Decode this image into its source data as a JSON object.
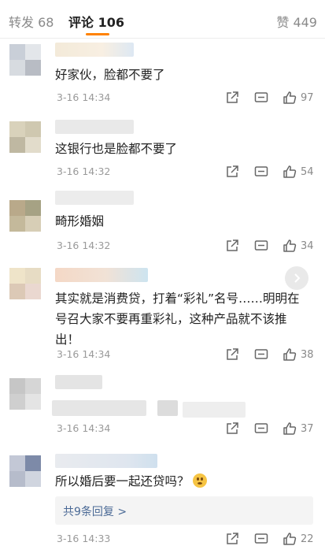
{
  "tabs": {
    "forward": "转发 68",
    "comments": "评论 106",
    "likes": "赞 449"
  },
  "comments": [
    {
      "text": "好家伙，脸都不要了",
      "time": "3-16 14:34",
      "likes": "97"
    },
    {
      "text": "这银行也是脸都不要了",
      "time": "3-16 14:32",
      "likes": "54"
    },
    {
      "text": "畸形婚姻",
      "time": "3-16 14:32",
      "likes": "34"
    },
    {
      "text": "其实就是消费贷，打着“彩礼”名号……明明在号召大家不要再重彩礼，这种产品就不该推出！",
      "time": "3-16 14:34",
      "likes": "38"
    },
    {
      "text": "",
      "time": "3-16 14:34",
      "likes": "37"
    },
    {
      "text": "所以婚后要一起还贷吗？",
      "time": "3-16 14:33",
      "likes": "22",
      "replies": "共9条回复 >"
    }
  ],
  "icons": {
    "share": "share-icon",
    "reply": "comment-icon",
    "like": "thumbs-up-icon",
    "emoji": "thinking-face-emoji"
  },
  "colors": {
    "accent": "#ff8200",
    "link": "#4b6a96",
    "muted": "#9a9a9a"
  }
}
